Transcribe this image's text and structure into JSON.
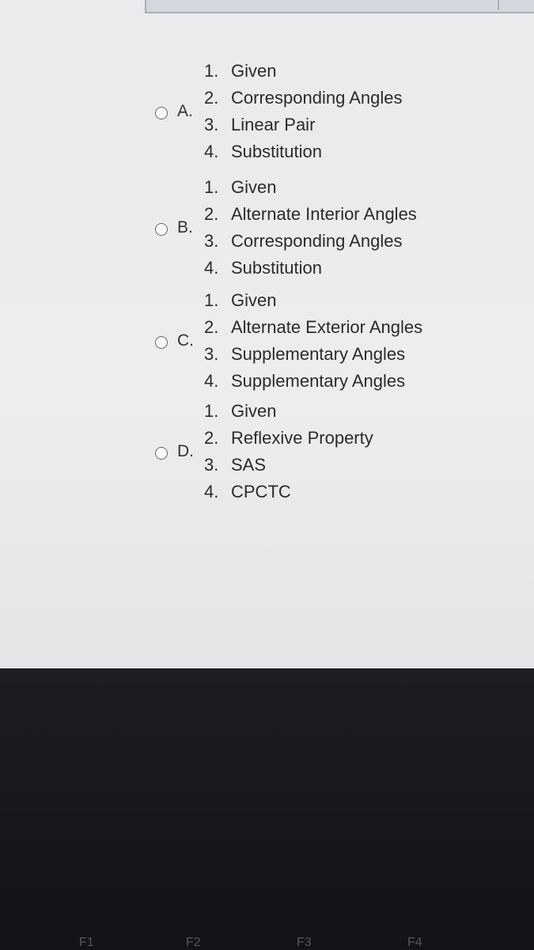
{
  "options": [
    {
      "letter": "A.",
      "steps": [
        {
          "num": "1.",
          "text": "Given"
        },
        {
          "num": "2.",
          "text": "Corresponding Angles"
        },
        {
          "num": "3.",
          "text": "Linear Pair"
        },
        {
          "num": "4.",
          "text": "Substitution"
        }
      ]
    },
    {
      "letter": "B.",
      "steps": [
        {
          "num": "1.",
          "text": "Given"
        },
        {
          "num": "2.",
          "text": "Alternate Interior Angles"
        },
        {
          "num": "3.",
          "text": "Corresponding Angles"
        },
        {
          "num": "4.",
          "text": "Substitution"
        }
      ]
    },
    {
      "letter": "C.",
      "steps": [
        {
          "num": "1.",
          "text": "Given"
        },
        {
          "num": "2.",
          "text": "Alternate Exterior Angles"
        },
        {
          "num": "3.",
          "text": "Supplementary Angles"
        },
        {
          "num": "4.",
          "text": "Supplementary Angles"
        }
      ]
    },
    {
      "letter": "D.",
      "steps": [
        {
          "num": "1.",
          "text": "Given"
        },
        {
          "num": "2.",
          "text": "Reflexive Property"
        },
        {
          "num": "3.",
          "text": "SAS"
        },
        {
          "num": "4.",
          "text": "CPCTC"
        }
      ]
    }
  ],
  "keyboard": {
    "keys": [
      "F1",
      "F2",
      "F3",
      "F4"
    ]
  }
}
